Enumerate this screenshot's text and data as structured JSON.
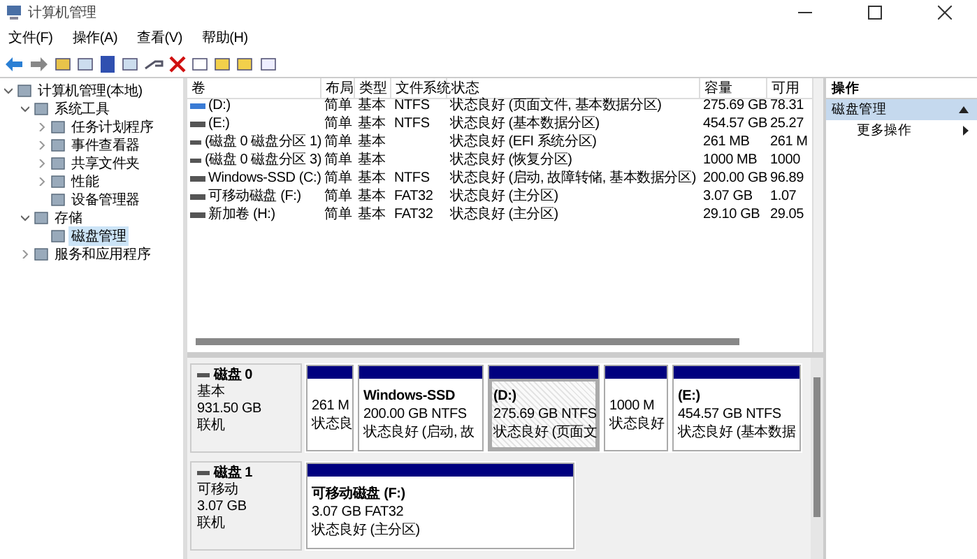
{
  "window": {
    "title": "计算机管理"
  },
  "menu": [
    "文件(F)",
    "操作(A)",
    "查看(V)",
    "帮助(H)"
  ],
  "tree": [
    {
      "label": "计算机管理(本地)",
      "expanded": true,
      "selected": false,
      "children": [
        {
          "label": "系统工具",
          "expanded": true,
          "selected": false,
          "children": [
            {
              "label": "任务计划程序",
              "expanded": false,
              "selected": false
            },
            {
              "label": "事件查看器",
              "expanded": false,
              "selected": false
            },
            {
              "label": "共享文件夹",
              "expanded": false,
              "selected": false
            },
            {
              "label": "性能",
              "expanded": false,
              "selected": false
            },
            {
              "label": "设备管理器",
              "selected": false
            }
          ]
        },
        {
          "label": "存储",
          "expanded": true,
          "selected": false,
          "children": [
            {
              "label": "磁盘管理",
              "selected": true
            }
          ]
        },
        {
          "label": "服务和应用程序",
          "expanded": false,
          "selected": false
        }
      ]
    }
  ],
  "table": {
    "columns": [
      "卷",
      "布局",
      "类型",
      "文件系统",
      "状态",
      "容量",
      "可用"
    ],
    "rows": [
      {
        "kind": "accent",
        "cells": [
          "(D:)",
          "简单",
          "基本",
          "NTFS",
          "状态良好 (页面文件, 基本数据分区)",
          "275.69 GB",
          "78.31"
        ]
      },
      {
        "kind": "plain",
        "cells": [
          "(E:)",
          "简单",
          "基本",
          "NTFS",
          "状态良好 (基本数据分区)",
          "454.57 GB",
          "25.27"
        ]
      },
      {
        "kind": "plain",
        "cells": [
          "(磁盘 0 磁盘分区 1)",
          "简单",
          "基本",
          "",
          "状态良好 (EFI 系统分区)",
          "261 MB",
          "261 M"
        ]
      },
      {
        "kind": "plain",
        "cells": [
          "(磁盘 0 磁盘分区 3)",
          "简单",
          "基本",
          "",
          "状态良好 (恢复分区)",
          "1000 MB",
          "1000"
        ]
      },
      {
        "kind": "plain",
        "cells": [
          "Windows-SSD (C:)",
          "简单",
          "基本",
          "NTFS",
          "状态良好 (启动, 故障转储, 基本数据分区)",
          "200.00 GB",
          "96.89"
        ]
      },
      {
        "kind": "plain",
        "cells": [
          "可移动磁盘 (F:)",
          "简单",
          "基本",
          "FAT32",
          "状态良好 (主分区)",
          "3.07 GB",
          "1.07"
        ]
      },
      {
        "kind": "plain",
        "cells": [
          "新加卷 (H:)",
          "简单",
          "基本",
          "FAT32",
          "状态良好 (主分区)",
          "29.10 GB",
          "29.05"
        ]
      }
    ]
  },
  "disks": [
    {
      "name": "磁盘 0",
      "type": "基本",
      "size": "931.50 GB",
      "status": "联机",
      "partitions": [
        {
          "size": "261 M",
          "status": "状态良",
          "selected": false
        },
        {
          "name": "Windows-SSD",
          "size": "200.00 GB NTFS",
          "status": "状态良好 (启动, 故",
          "selected": false
        },
        {
          "name": "(D:)",
          "size": "275.69 GB NTFS",
          "status": "状态良好 (页面文",
          "selected": true
        },
        {
          "size": "1000 M",
          "status": "状态良好",
          "selected": false
        },
        {
          "name": "(E:)",
          "size": "454.57 GB NTFS",
          "status": "状态良好 (基本数据",
          "selected": false
        }
      ]
    },
    {
      "name": "磁盘 1",
      "type": "可移动",
      "size": "3.07 GB",
      "status": "联机",
      "partitions": [
        {
          "name": "可移动磁盘 (F:)",
          "size": "3.07 GB FAT32",
          "status": "状态良好 (主分区)",
          "selected": false
        }
      ]
    }
  ],
  "actions": {
    "title": "操作",
    "section": "磁盘管理",
    "items": [
      "更多操作"
    ]
  }
}
